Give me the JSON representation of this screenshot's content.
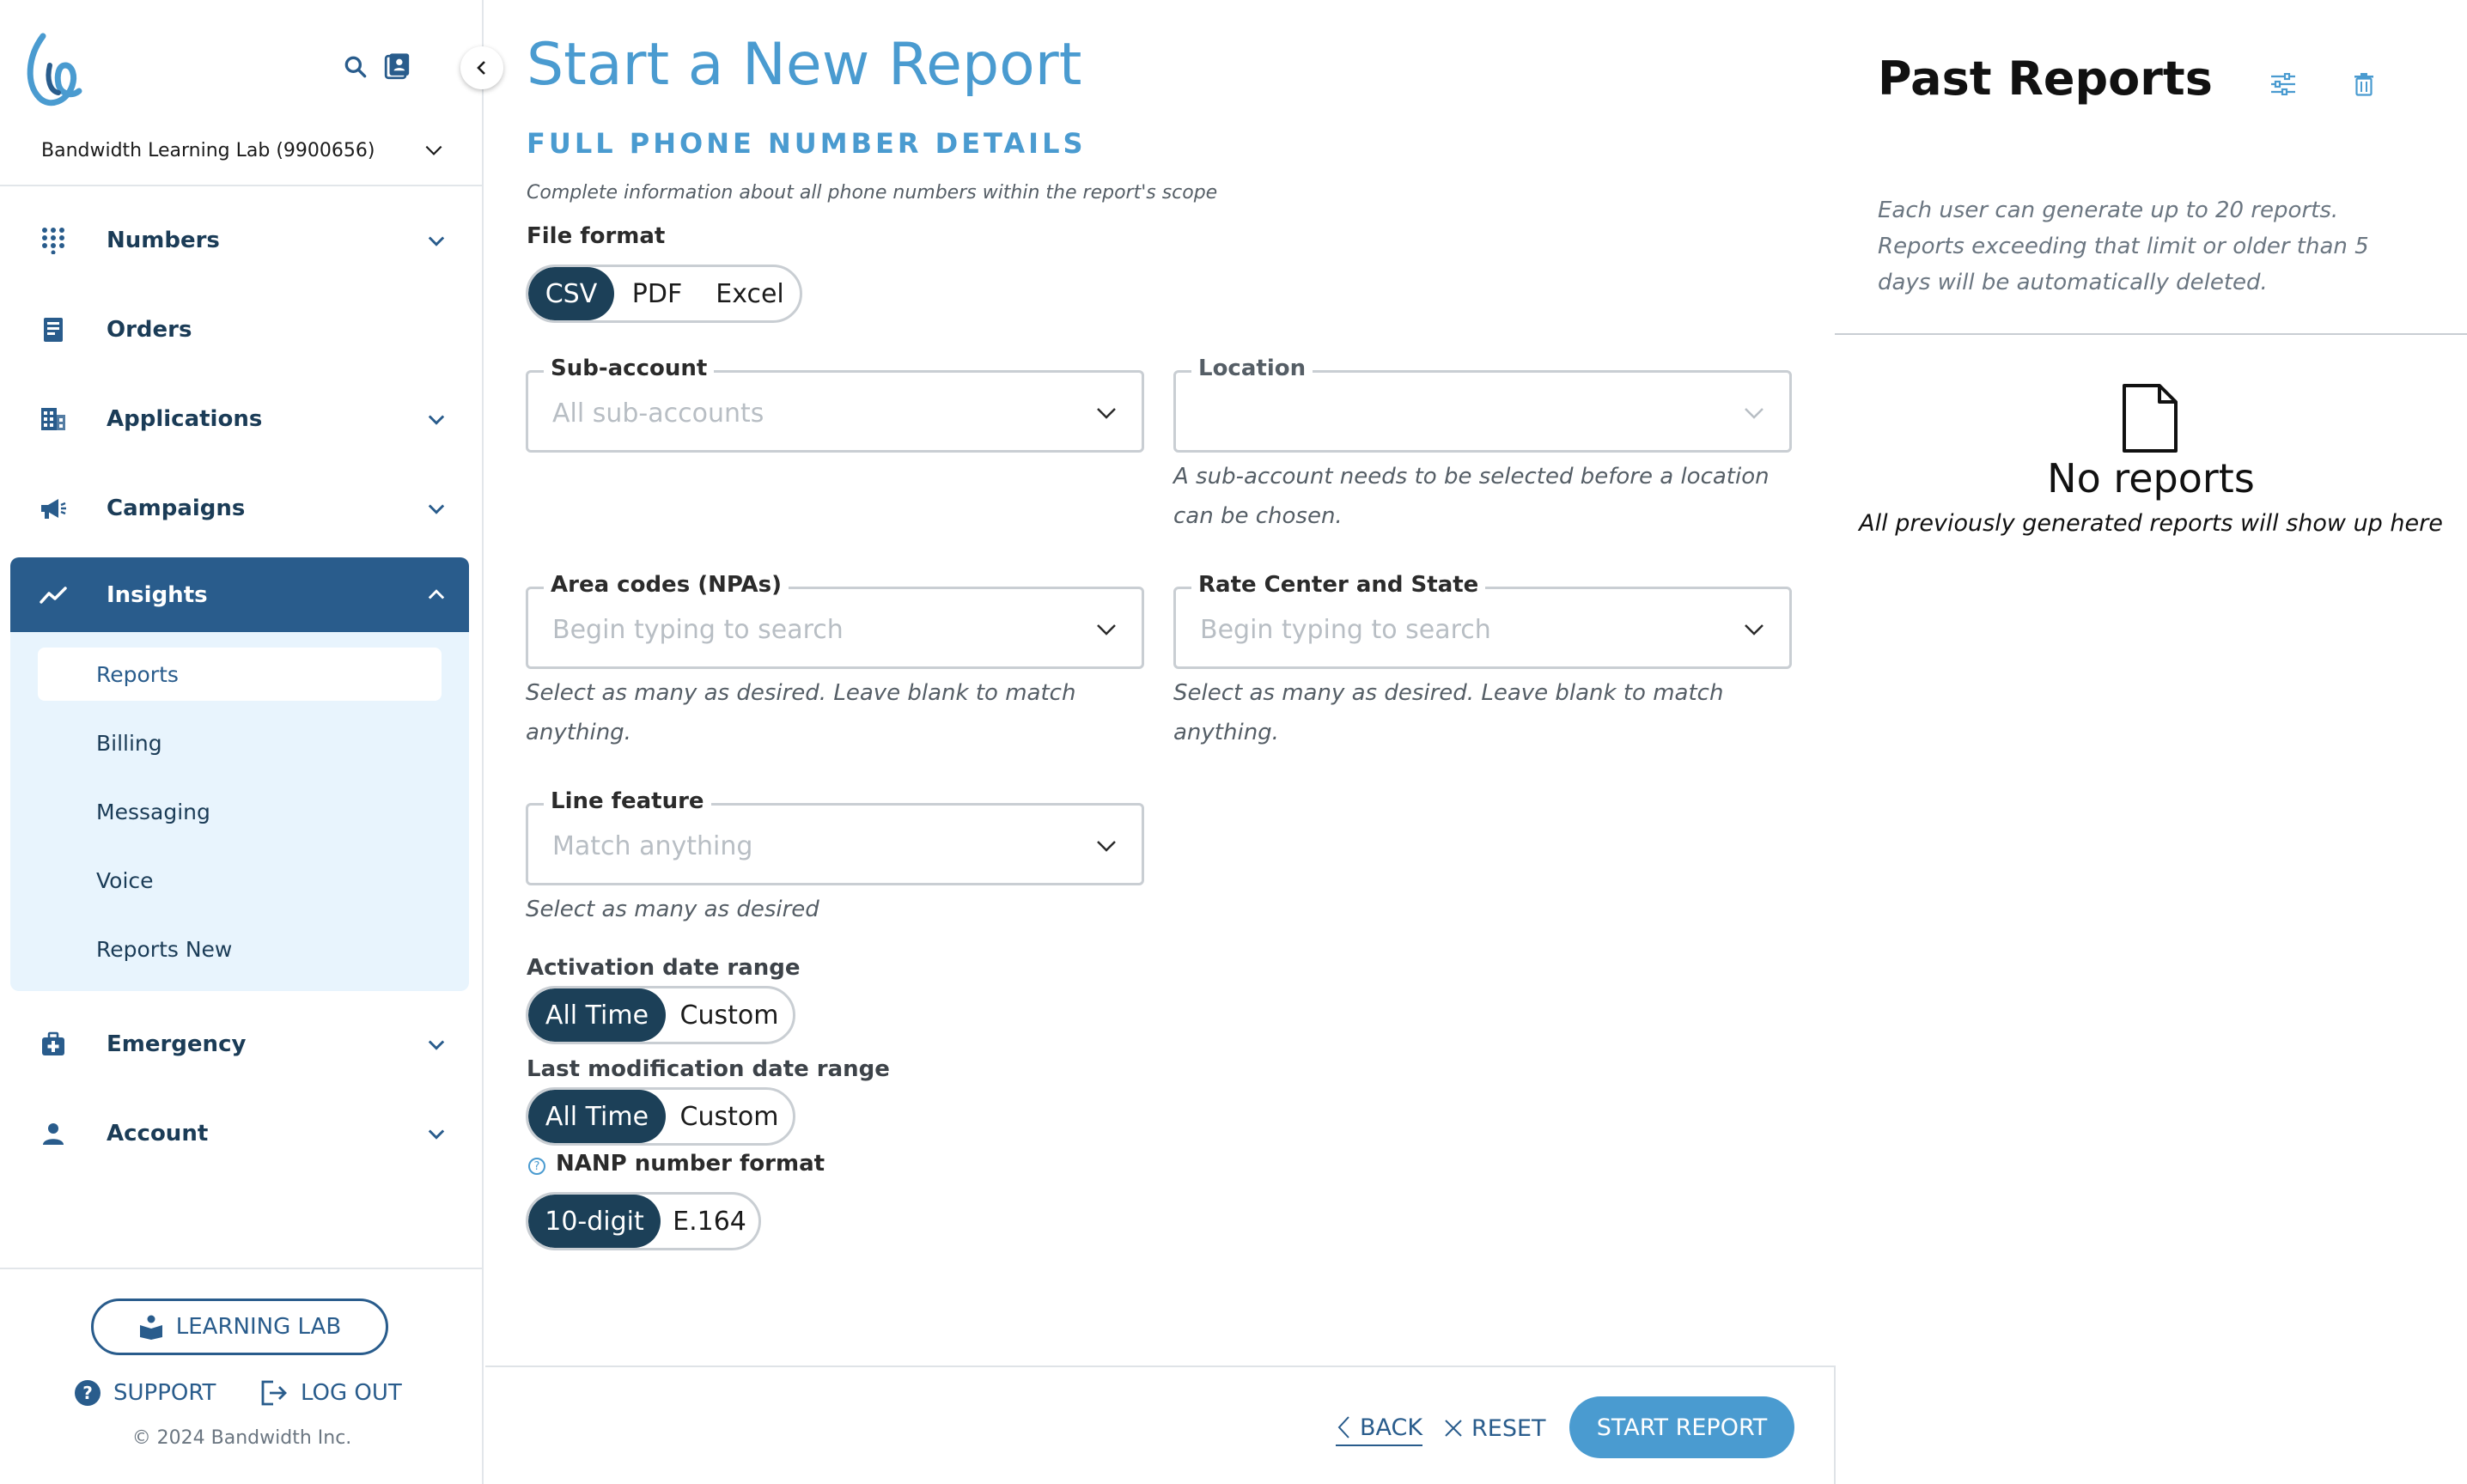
{
  "sidebar": {
    "account_label": "Bandwidth Learning Lab (9900656)",
    "nav": [
      {
        "label": "Numbers",
        "icon": "keypad-icon"
      },
      {
        "label": "Orders",
        "icon": "receipt-icon"
      },
      {
        "label": "Applications",
        "icon": "building-icon"
      },
      {
        "label": "Campaigns",
        "icon": "megaphone-icon"
      },
      {
        "label": "Insights",
        "icon": "trend-icon"
      },
      {
        "label": "Emergency",
        "icon": "first-aid-icon"
      },
      {
        "label": "Account",
        "icon": "person-icon"
      }
    ],
    "sub_items": [
      "Reports",
      "Billing",
      "Messaging",
      "Voice",
      "Reports New"
    ],
    "learning_lab": "LEARNING LAB",
    "support": "SUPPORT",
    "logout": "LOG OUT",
    "copyright": "© 2024 Bandwidth Inc."
  },
  "main": {
    "title": "Start a New Report",
    "section_title": "FULL PHONE NUMBER DETAILS",
    "section_desc": "Complete information about all phone numbers within the report's scope",
    "file_format": {
      "label": "File format",
      "options": [
        "CSV",
        "PDF",
        "Excel"
      ],
      "selected": "CSV"
    },
    "sub_account": {
      "label": "Sub-account",
      "placeholder": "All sub-accounts"
    },
    "location": {
      "label": "Location",
      "placeholder": "",
      "helper": "A sub-account needs to be selected before a location can be chosen."
    },
    "area_codes": {
      "label": "Area codes (NPAs)",
      "placeholder": "Begin typing to search",
      "helper": "Select as many as desired. Leave blank to match anything."
    },
    "rate_center": {
      "label": "Rate Center and State",
      "placeholder": "Begin typing to search",
      "helper": "Select as many as desired. Leave blank to match anything."
    },
    "line_feature": {
      "label": "Line feature",
      "placeholder": "Match anything",
      "helper": "Select as many as desired"
    },
    "activation": {
      "label": "Activation date range",
      "options": [
        "All Time",
        "Custom"
      ],
      "selected": "All Time"
    },
    "last_mod": {
      "label": "Last modification date range",
      "options": [
        "All Time",
        "Custom"
      ],
      "selected": "All Time"
    },
    "nanp": {
      "label": "NANP number format",
      "info": "?",
      "options": [
        "10-digit",
        "E.164"
      ],
      "selected": "10-digit"
    },
    "back": "BACK",
    "reset": "RESET",
    "start": "START REPORT"
  },
  "right": {
    "title": "Past Reports",
    "desc": "Each user can generate up to 20 reports. Reports exceeding that limit or older than 5 days will be automatically deleted.",
    "empty_title": "No reports",
    "empty_sub": "All previously generated reports will show up here"
  },
  "colors": {
    "accent": "#4a9bd0",
    "nav_active": "#295c8c",
    "toggle_on": "#1c4058",
    "subnav_bg": "#e8f4fd"
  }
}
